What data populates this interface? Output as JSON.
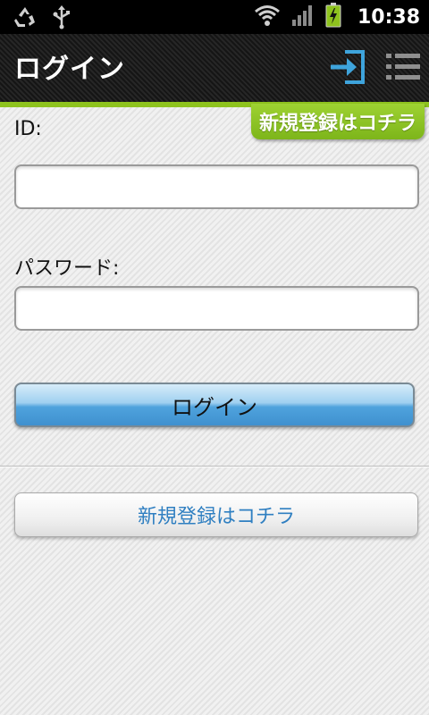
{
  "status_bar": {
    "time": "10:38",
    "icons": [
      "recycle-icon",
      "usb-icon",
      "wifi-icon",
      "signal-icon",
      "battery-charging-icon"
    ]
  },
  "action_bar": {
    "title": "ログイン",
    "register_tab_label": "新規登録はコチラ",
    "actions": [
      "login-icon",
      "menu-list-icon"
    ]
  },
  "form": {
    "id_label": "ID:",
    "id_value": "",
    "password_label": "パスワード:",
    "password_value": "",
    "login_button_label": "ログイン",
    "register_button_label": "新規登録はコチラ"
  },
  "colors": {
    "accent_green": "#8ec31e",
    "login_icon_blue": "#3ea4dc",
    "register_link_blue": "#2f7fc1",
    "login_button_blue": "#4fa3dd"
  }
}
